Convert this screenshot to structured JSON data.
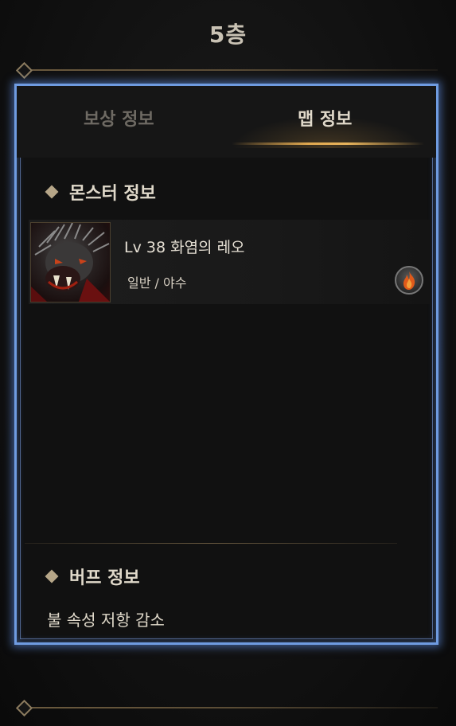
{
  "header": {
    "floor_title": "5층"
  },
  "tabs": [
    {
      "label": "보상 정보",
      "active": false
    },
    {
      "label": "맵 정보",
      "active": true
    }
  ],
  "monster_section": {
    "title": "몬스터 정보",
    "monsters": [
      {
        "name": "Lv 38 화염의 레오",
        "type": "일반 / 야수",
        "portrait_icon": "werewolf-portrait",
        "element_icon": "fire-element-icon"
      }
    ]
  },
  "buff_section": {
    "title": "버프 정보",
    "buffs": [
      "불 속성 저항 감소"
    ]
  },
  "colors": {
    "panel_border": "#6f9be0",
    "tab_active_underline": "#e0a850",
    "fire": "#e05a1a"
  }
}
